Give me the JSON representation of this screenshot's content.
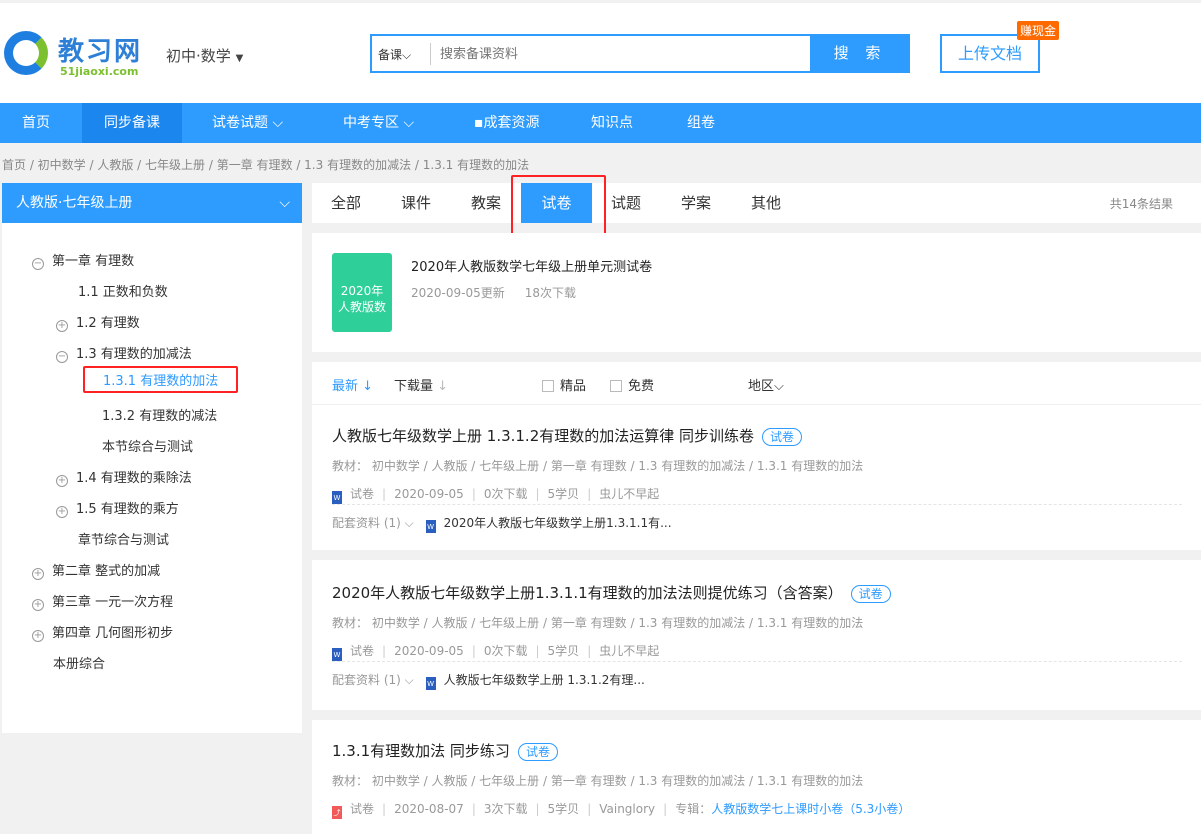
{
  "header": {
    "logo": "教习网",
    "logo_sub": "51jiaoxi.com",
    "subject": "初中·数学",
    "search_type": "备课",
    "search_placeholder": "搜索备课资料",
    "search_button": "搜 索",
    "upload": "上传文档",
    "badge": "赚现金"
  },
  "nav": [
    "首页",
    "同步备课",
    "试卷试题",
    "中考专区",
    "成套资源",
    "知识点",
    "组卷"
  ],
  "breadcrumb": "首页 / 初中数学 / 人教版 / 七年级上册 / 第一章 有理数 / 1.3 有理数的加减法 / 1.3.1 有理数的加法",
  "sidebar": {
    "title": "人教版·七年级上册",
    "items": [
      "第一章 有理数",
      "1.1 正数和负数",
      "1.2 有理数",
      "1.3 有理数的加减法",
      "1.3.1 有理数的加法",
      "1.3.2 有理数的减法",
      "本节综合与测试",
      "1.4 有理数的乘除法",
      "1.5 有理数的乘方",
      "章节综合与测试",
      "第二章 整式的加减",
      "第三章 一元一次方程",
      "第四章 几何图形初步",
      "本册综合"
    ]
  },
  "tabs": [
    "全部",
    "课件",
    "教案",
    "试卷",
    "试题",
    "学案",
    "其他"
  ],
  "result_count": "共14条结果",
  "featured": {
    "cover_line1": "2020年",
    "cover_line2": "人教版数",
    "title": "2020年人教版数学七年级上册单元测试卷",
    "updated": "2020-09-05更新",
    "downloads": "18次下载"
  },
  "filters": {
    "latest": "最新",
    "downloads": "下载量",
    "premium": "精品",
    "free": "免费",
    "region": "地区"
  },
  "results": [
    {
      "title": "人教版七年级数学上册 1.3.1.2有理数的加法运算律 同步训练卷",
      "tag": "试卷",
      "path": "教材： 初中数学 / 人教版 / 七年级上册 / 第一章 有理数 / 1.3 有理数的加减法 / 1.3.1 有理数的加法",
      "type": "试卷",
      "date": "2020-09-05",
      "dl": "0次下载",
      "price": "5学贝",
      "author": "虫儿不早起",
      "related": "配套资料 (1)",
      "related_doc": "2020年人教版七年级数学上册1.3.1.1有..."
    },
    {
      "title": "2020年人教版七年级数学上册1.3.1.1有理数的加法法则提优练习（含答案）",
      "tag": "试卷",
      "path": "教材： 初中数学 / 人教版 / 七年级上册 / 第一章 有理数 / 1.3 有理数的加减法 / 1.3.1 有理数的加法",
      "type": "试卷",
      "date": "2020-09-05",
      "dl": "0次下载",
      "price": "5学贝",
      "author": "虫儿不早起",
      "related": "配套资料 (1)",
      "related_doc": "人教版七年级数学上册 1.3.1.2有理..."
    },
    {
      "title": "1.3.1有理数加法 同步练习",
      "tag": "试卷",
      "path": "教材： 初中数学 / 人教版 / 七年级上册 / 第一章 有理数 / 1.3 有理数的加减法 / 1.3.1 有理数的加法",
      "type": "试卷",
      "date": "2020-08-07",
      "dl": "3次下载",
      "price": "5学贝",
      "author": "Vainglory",
      "album_label": "专辑：",
      "album": "人教版数学七上课时小卷（5.3小卷）"
    }
  ]
}
